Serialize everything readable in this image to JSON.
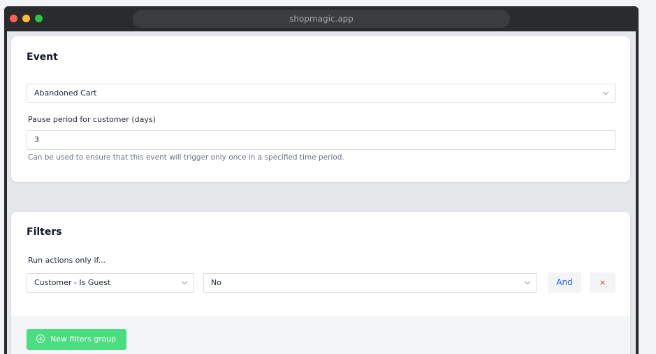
{
  "browser": {
    "url": "shopmagic.app"
  },
  "event_card": {
    "title": "Event",
    "event_select_value": "Abandoned Cart",
    "pause_label": "Pause period for customer (days)",
    "pause_value": "3",
    "pause_help": "Can be used to ensure that this event will trigger only once in a specified time period."
  },
  "filters_card": {
    "title": "Filters",
    "run_label": "Run actions only if...",
    "filter_field_value": "Customer - Is Guest",
    "filter_value": "No",
    "and_label": "And",
    "remove_label": "×",
    "new_group_label": "New filters group"
  },
  "colors": {
    "accent_blue": "#2563eb",
    "remove_red": "#dc2626",
    "new_group_green": "#4ade80"
  }
}
